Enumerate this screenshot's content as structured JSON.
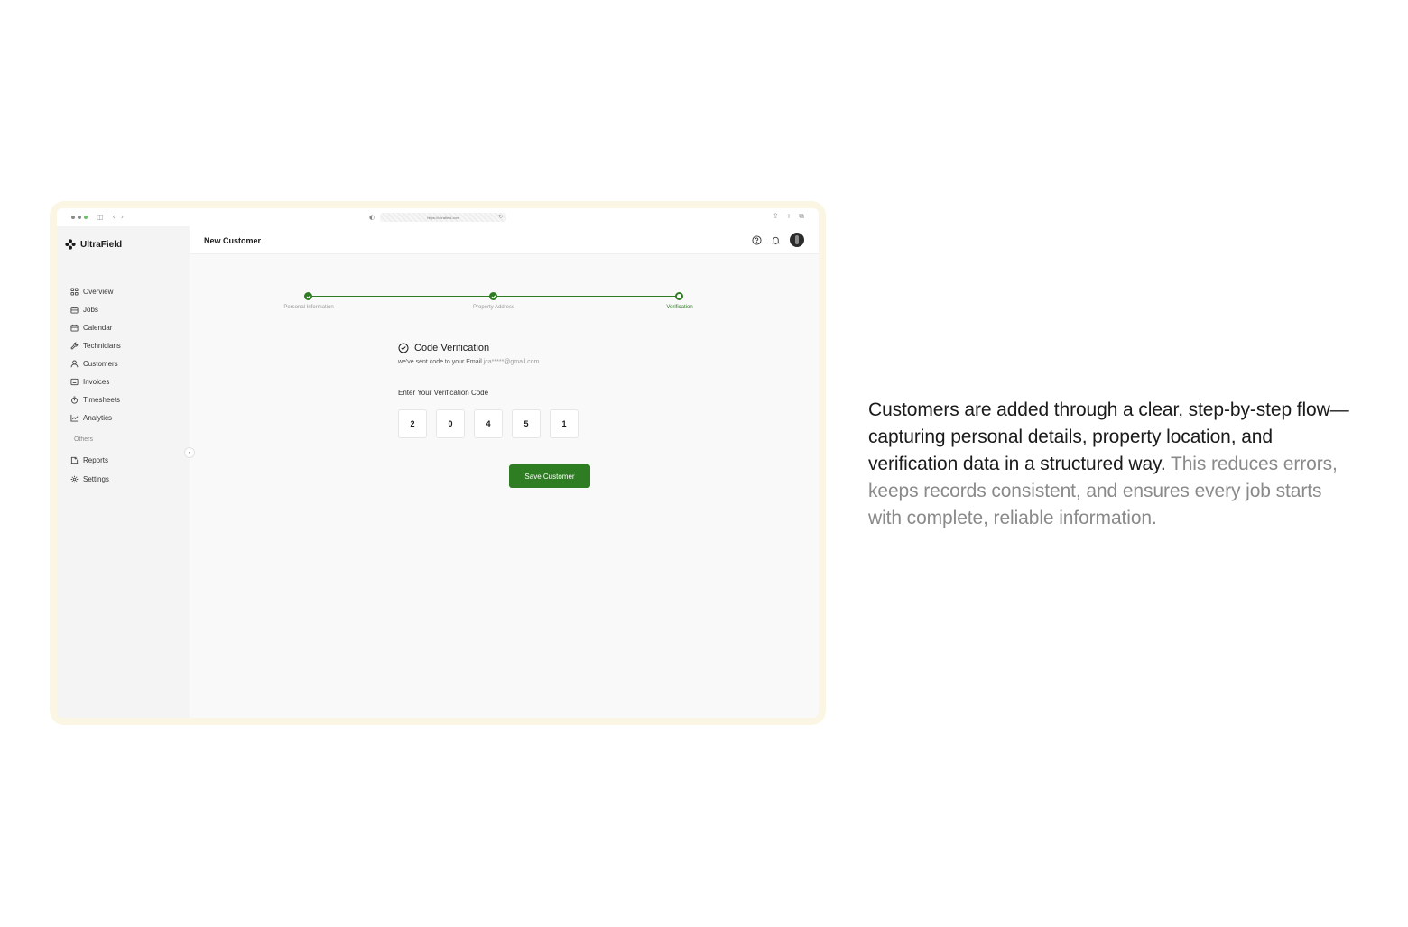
{
  "browser": {
    "url": "https://ultrafield.com"
  },
  "sidebar": {
    "brand": "UltraField",
    "items": [
      {
        "label": "Overview",
        "icon": "grid-icon"
      },
      {
        "label": "Jobs",
        "icon": "briefcase-icon"
      },
      {
        "label": "Calendar",
        "icon": "calendar-icon"
      },
      {
        "label": "Technicians",
        "icon": "wrench-icon"
      },
      {
        "label": "Customers",
        "icon": "user-icon"
      },
      {
        "label": "Invoices",
        "icon": "invoice-icon"
      },
      {
        "label": "Timesheets",
        "icon": "stopwatch-icon"
      },
      {
        "label": "Analytics",
        "icon": "chart-line-icon"
      }
    ],
    "others_label": "Others",
    "other_items": [
      {
        "label": "Reports",
        "icon": "report-icon"
      },
      {
        "label": "Settings",
        "icon": "gear-icon"
      }
    ]
  },
  "header": {
    "title": "New Customer"
  },
  "stepper": {
    "steps": [
      {
        "label": "Personal Information",
        "state": "done"
      },
      {
        "label": "Property Address",
        "state": "done"
      },
      {
        "label": "Verification",
        "state": "current"
      }
    ]
  },
  "verification": {
    "title": "Code Verification",
    "subtitle": "we've sent code to your Email",
    "email": "jca*****@gmail.com",
    "code_label": "Enter Your Verification Code",
    "digits": [
      "2",
      "0",
      "4",
      "5",
      "1"
    ],
    "save_label": "Save Customer"
  },
  "description": {
    "main": "Customers are added through a clear, step-by-step flow—capturing personal details, property location, and verification data in a structured way.",
    "muted": "This reduces errors, keeps records consistent, and ensures every job starts with complete, reliable information."
  },
  "colors": {
    "accent": "#2e7d22",
    "frame": "#fbf6e3",
    "sidebar_bg": "#f4f4f4"
  }
}
